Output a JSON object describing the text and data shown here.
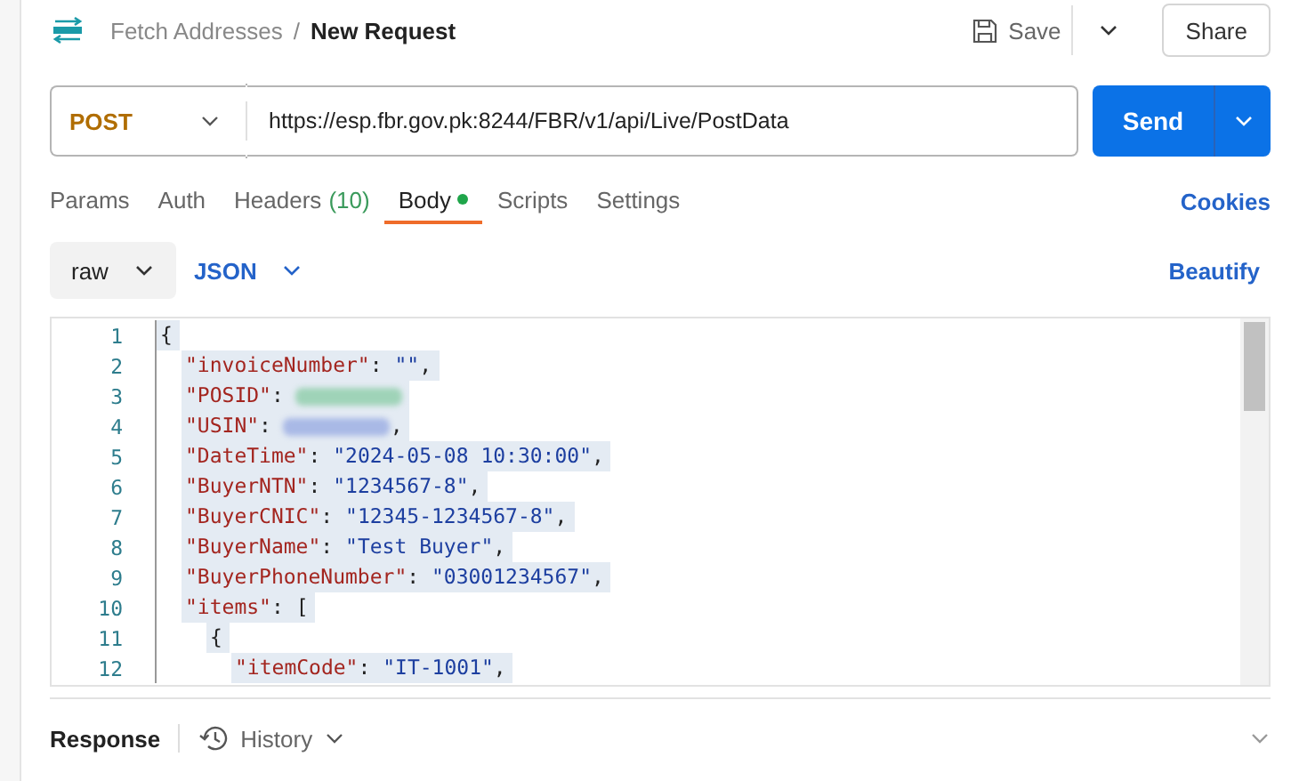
{
  "breadcrumb": {
    "collection": "Fetch Addresses",
    "separator": "/",
    "request": "New Request"
  },
  "save_button": "Save",
  "share_button": "Share",
  "request": {
    "method": "POST",
    "url": "https://esp.fbr.gov.pk:8244/FBR/v1/api/Live/PostData",
    "send_button": "Send"
  },
  "tabs": [
    {
      "label": "Params",
      "selected": false
    },
    {
      "label": "Auth",
      "selected": false
    },
    {
      "label": "Headers",
      "count": "(10)",
      "selected": false
    },
    {
      "label": "Body",
      "dot": true,
      "selected": true
    },
    {
      "label": "Scripts",
      "selected": false
    },
    {
      "label": "Settings",
      "selected": false
    }
  ],
  "cookies_link": "Cookies",
  "body_type": "raw",
  "body_format": "JSON",
  "beautify_link": "Beautify",
  "editor_lines": [
    {
      "number": "1",
      "selected": true,
      "segments": [
        {
          "kind": "punct",
          "text": "{"
        }
      ],
      "children": [
        {
          "number": "2",
          "selected": true,
          "segments": [
            {
              "kind": "key",
              "text": "\"invoiceNumber\""
            },
            {
              "kind": "punct",
              "text": ": "
            },
            {
              "kind": "string",
              "text": "\"\""
            },
            {
              "kind": "punct",
              "text": ","
            }
          ]
        },
        {
          "number": "3",
          "selected": true,
          "segments": [
            {
              "kind": "key",
              "text": "\"POSID\""
            },
            {
              "kind": "punct",
              "text": ": "
            },
            {
              "kind": "redacted",
              "color": "#9fd3b8"
            }
          ]
        },
        {
          "number": "4",
          "selected": true,
          "segments": [
            {
              "kind": "key",
              "text": "\"USIN\""
            },
            {
              "kind": "punct",
              "text": ": "
            },
            {
              "kind": "redacted",
              "color": "#a9b9e6"
            },
            {
              "kind": "punct",
              "text": ","
            }
          ]
        },
        {
          "number": "5",
          "selected": true,
          "segments": [
            {
              "kind": "key",
              "text": "\"DateTime\""
            },
            {
              "kind": "punct",
              "text": ": "
            },
            {
              "kind": "string",
              "text": "\"2024-05-08 10:30:00\""
            },
            {
              "kind": "punct",
              "text": ","
            }
          ]
        },
        {
          "number": "6",
          "selected": true,
          "segments": [
            {
              "kind": "key",
              "text": "\"BuyerNTN\""
            },
            {
              "kind": "punct",
              "text": ": "
            },
            {
              "kind": "string",
              "text": "\"1234567-8\""
            },
            {
              "kind": "punct",
              "text": ","
            }
          ]
        },
        {
          "number": "7",
          "selected": true,
          "segments": [
            {
              "kind": "key",
              "text": "\"BuyerCNIC\""
            },
            {
              "kind": "punct",
              "text": ": "
            },
            {
              "kind": "string",
              "text": "\"12345-1234567-8\""
            },
            {
              "kind": "punct",
              "text": ","
            }
          ]
        },
        {
          "number": "8",
          "selected": true,
          "segments": [
            {
              "kind": "key",
              "text": "\"BuyerName\""
            },
            {
              "kind": "punct",
              "text": ": "
            },
            {
              "kind": "string",
              "text": "\"Test Buyer\""
            },
            {
              "kind": "punct",
              "text": ","
            }
          ]
        },
        {
          "number": "9",
          "selected": true,
          "segments": [
            {
              "kind": "key",
              "text": "\"BuyerPhoneNumber\""
            },
            {
              "kind": "punct",
              "text": ": "
            },
            {
              "kind": "string",
              "text": "\"03001234567\""
            },
            {
              "kind": "punct",
              "text": ","
            }
          ]
        },
        {
          "number": "10",
          "selected": true,
          "segments": [
            {
              "kind": "key",
              "text": "\"items\""
            },
            {
              "kind": "punct",
              "text": ": ["
            }
          ],
          "children": [
            {
              "number": "11",
              "selected": true,
              "segments": [
                {
                  "kind": "punct",
                  "text": "{"
                }
              ],
              "children": [
                {
                  "number": "12",
                  "selected": true,
                  "segments": [
                    {
                      "kind": "key",
                      "text": "\"itemCode\""
                    },
                    {
                      "kind": "punct",
                      "text": ": "
                    },
                    {
                      "kind": "string",
                      "text": "\"IT-1001\""
                    },
                    {
                      "kind": "punct",
                      "text": ","
                    }
                  ]
                }
              ]
            }
          ]
        }
      ]
    }
  ],
  "response_label": "Response",
  "history_button": "History"
}
